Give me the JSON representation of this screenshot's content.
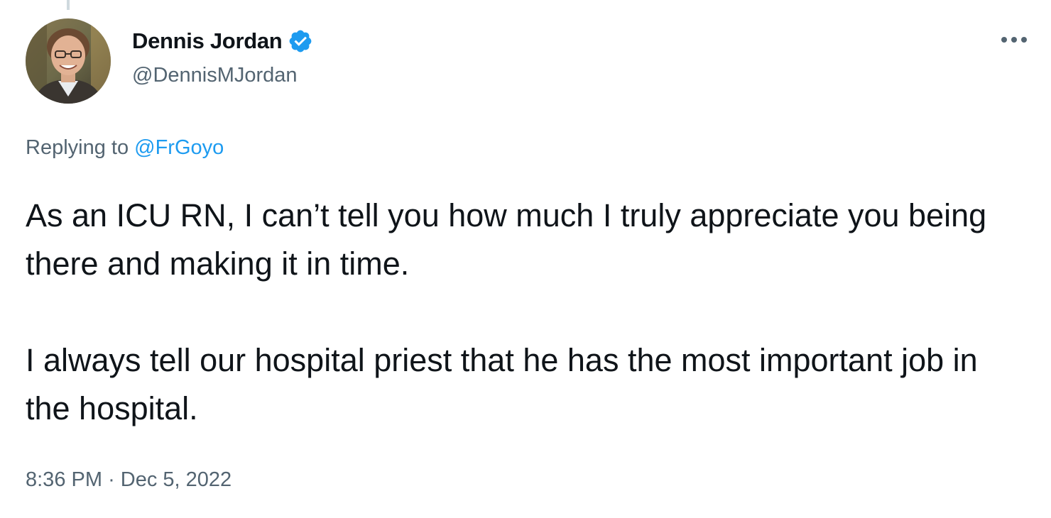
{
  "tweet": {
    "author": {
      "display_name": "Dennis Jordan",
      "handle": "@DennisMJordan",
      "verified": true,
      "avatar_icon": "profile-photo"
    },
    "reply_prefix": "Replying to",
    "reply_to": "@FrGoyo",
    "paragraphs": [
      "As an ICU RN, I can’t tell you how much I truly appreciate you being there and making it in time.",
      "I always tell our hospital priest that he has the most important job in the hospital."
    ],
    "time": "8:36 PM",
    "separator": "·",
    "date": "Dec 5, 2022"
  },
  "icons": {
    "verified": "verified-badge-icon",
    "more": "more-options-icon"
  },
  "colors": {
    "text_primary": "#0f1419",
    "text_secondary": "#536471",
    "accent": "#1d9bf0",
    "thread_line": "#cfd9de"
  }
}
